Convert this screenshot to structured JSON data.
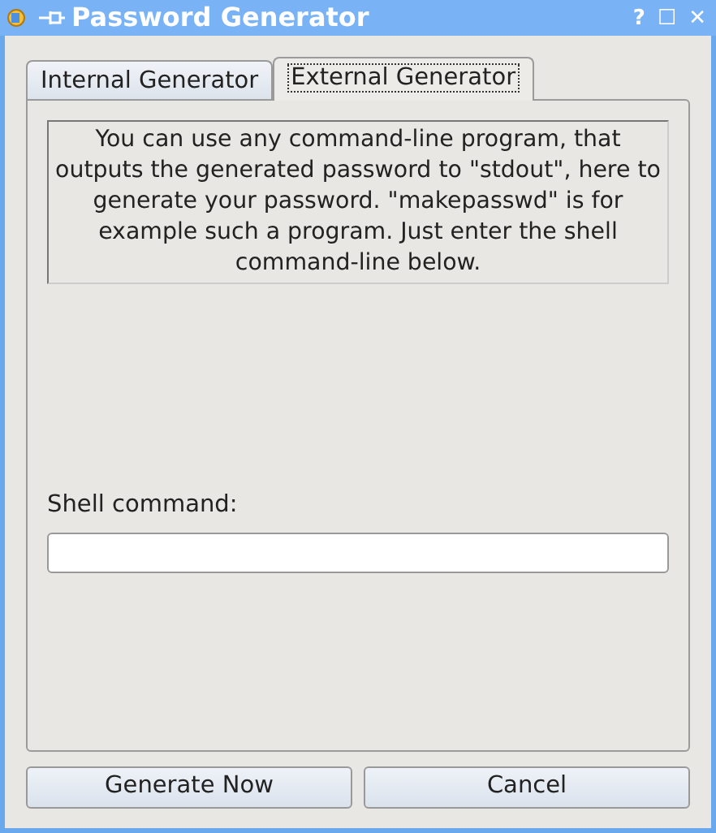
{
  "window": {
    "title": "Password Generator",
    "controls": [
      "?",
      "☐",
      "✕"
    ]
  },
  "tabs": [
    {
      "label": "Internal Generator",
      "selected": false
    },
    {
      "label": "External Generator",
      "selected": true
    }
  ],
  "info_text": "You can use any command-line program, that outputs the generated password to \"stdout\", here to generate your password. \"makepasswd\" is for example such a program. Just enter the shell command-line below.",
  "shell_command": {
    "label": "Shell command:"
  },
  "buttons": [
    "Generate Now",
    "Cancel"
  ]
}
